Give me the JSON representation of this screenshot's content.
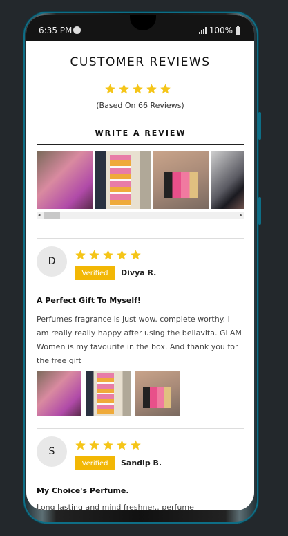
{
  "status": {
    "time": "6:35 PM",
    "battery": "100%"
  },
  "reviews_header": {
    "title": "CUSTOMER REVIEWS",
    "rating": 5,
    "based_on": "(Based On 66 Reviews)",
    "write_review": "WRITE A REVIEW"
  },
  "reviews": [
    {
      "initial": "D",
      "rating": 5,
      "verified": "Verified",
      "name": "Divya R.",
      "title": "A Perfect Gift To Myself!",
      "body": "Perfumes fragrance is just wow. complete worthy. I am really really happy after using the bellavita. GLAM Women is my favourite in the box. And thank you for the free gift"
    },
    {
      "initial": "S",
      "rating": 5,
      "verified": "Verified",
      "name": "Sandip B.",
      "title": "My Choice's Perfume.",
      "body": "Long lasting and mind freshner.. perfume"
    }
  ],
  "colors": {
    "star": "#f5c518",
    "verified_badge": "#f2b705",
    "frame_accent": "#0e6e86"
  }
}
